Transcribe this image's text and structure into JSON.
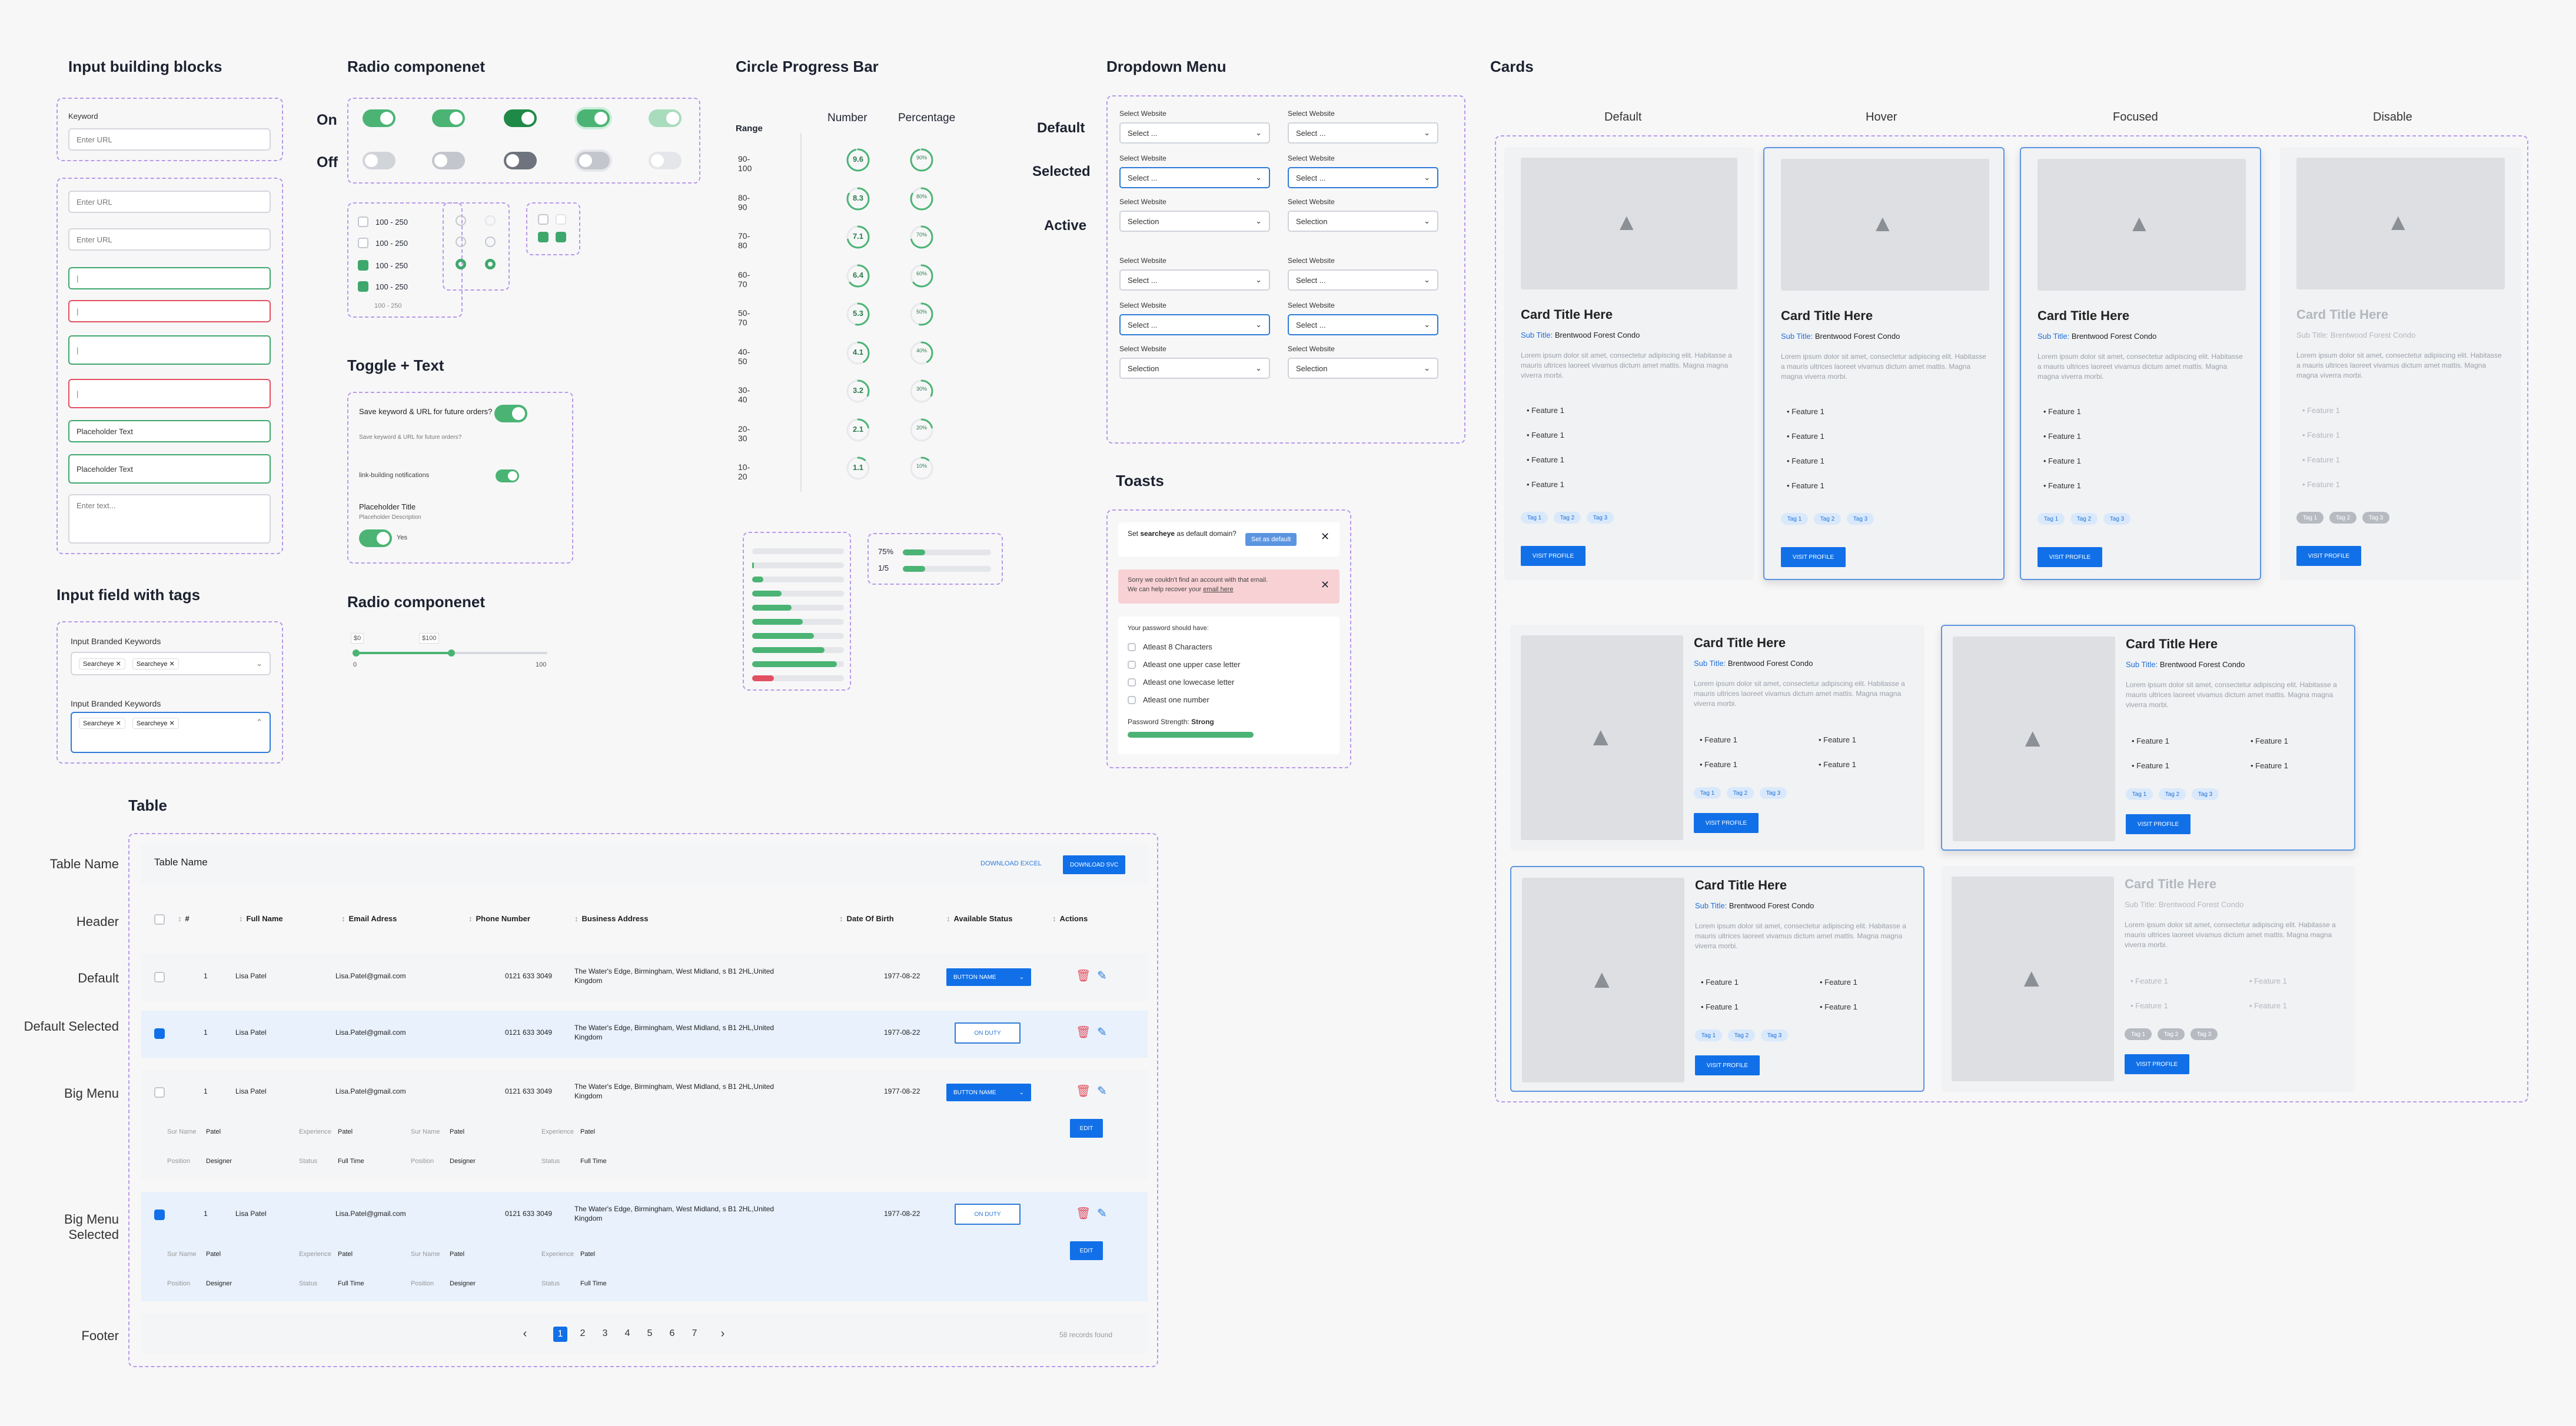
{
  "sections": {
    "input_blocks": "Input building blocks",
    "radio": "Radio componenet",
    "circle": "Circle Progress Bar",
    "dropdown": "Dropdown Menu",
    "cards": "Cards",
    "tags": "Input field with tags",
    "toggle_text": "Toggle + Text",
    "radio2": "Radio componenet",
    "toasts": "Toasts",
    "table": "Table"
  },
  "inputs": {
    "keyword_label": "Keyword",
    "url_placeholder": "Enter URL",
    "cursor": "|",
    "placeholder": "Placeholder Text",
    "textarea_placeholder": "Enter text..."
  },
  "radio": {
    "on": "On",
    "off": "Off",
    "options": [
      "100 - 250",
      "100 - 250",
      "100 - 250",
      "100 - 250",
      "100 - 250"
    ]
  },
  "toggle_text": {
    "t1": "Save keyword & URL for future orders?",
    "t1_desc": "Save keyword & URL for future orders?",
    "t2": "link-building notifications",
    "t3": "Placeholder Title",
    "t3_desc": "Placeholder Description",
    "yes": "Yes"
  },
  "tags": {
    "label": "Input Branded Keywords",
    "chip": "Searcheye"
  },
  "slider": {
    "min": "$0",
    "max": "$100",
    "start": "0",
    "end": "100",
    "value_fraction": 0.5
  },
  "circle": {
    "range_h": "Range",
    "number_h": "Number",
    "percent_h": "Percentage",
    "ranges": [
      "90-100",
      "80-90",
      "70-80",
      "60-70",
      "50-70",
      "40-50",
      "30-40",
      "20-30",
      "10-20"
    ],
    "numbers": [
      "9.6",
      "8.3",
      "7.1",
      "6.4",
      "5.3",
      "4.1",
      "3.2",
      "2.1",
      "1.1"
    ],
    "percents": [
      "90%",
      "80%",
      "70%",
      "60%",
      "50%",
      "40%",
      "30%",
      "20%",
      "10%"
    ],
    "fractions": [
      0.96,
      0.83,
      0.71,
      0.64,
      0.53,
      0.41,
      0.32,
      0.21,
      0.11
    ],
    "mini1": "75%",
    "mini2": "1/5"
  },
  "dropdown": {
    "default": "Default",
    "selected": "Selected",
    "active": "Active",
    "label": "Select Website",
    "select": "Select ...",
    "selection": "Selection"
  },
  "toasts": {
    "t1a": "Set ",
    "t1b": "searcheye",
    "t1c": " as default domain?",
    "t1_btn": "Set as default",
    "t2": "Sorry we couldn't find an account with that email.",
    "t2b": "We can help recover your ",
    "t2_link": "email here",
    "pw_h": "Your password should have:",
    "rules": [
      "Atleast 8 Characters",
      "Atleast one upper case letter",
      "Atleast one lowecase letter",
      "Atleast one number"
    ],
    "strength": "Password Strength: ",
    "strength_v": "Strong"
  },
  "cards": {
    "states": [
      "Default",
      "Hover",
      "Focused",
      "Disable"
    ],
    "title": "Card Title Here",
    "sub_label": "Sub Title:",
    "sub": " Brentwood Forest Condo",
    "desc": "Lorem ipsum dolor sit amet, consectetur adipiscing elit. Habitasse a mauris ultrices laoreet vivamus dictum amet mattis. Magna magna viverra morbi.",
    "feature": "Feature 1",
    "tags": [
      "Tag 1",
      "Tag 2",
      "Tag 3"
    ],
    "btn": "VISIT PROFILE"
  },
  "table": {
    "row_labels": [
      "Table Name",
      "Header",
      "Default",
      "Default Selected",
      "Big Menu",
      "Big Menu Selected",
      "Footer"
    ],
    "name": "Table Name",
    "excel": "DOWNLOAD EXCEL",
    "csv": "DOWNLOAD SVC",
    "cols": [
      "#",
      "Full Name",
      "Email Adress",
      "Phone Number",
      "Business Address",
      "Date Of Birth",
      "Available Status",
      "Actions"
    ],
    "row": {
      "n": "1",
      "name": "Lisa Patel",
      "email": "Lisa.Patel@gmail.com",
      "phone": "0121 633 3049",
      "addr1": "The Water's Edge, Birmingham, West Midland, s B1 2HL,United",
      "addr2": "Kingdom",
      "dob": "1977-08-22",
      "btn": "BUTTON NAME",
      "duty": "ON DUTY"
    },
    "detail": {
      "surname_l": "Sur Name",
      "surname": "Patel",
      "exp_l": "Experience",
      "exp": "Patel",
      "pos_l": "Position",
      "pos": "Designer",
      "status_l": "Status",
      "status": "Full Time",
      "edit": "EDIT"
    },
    "pages": [
      "1",
      "2",
      "3",
      "4",
      "5",
      "6",
      "7"
    ],
    "records": "58 records found"
  }
}
